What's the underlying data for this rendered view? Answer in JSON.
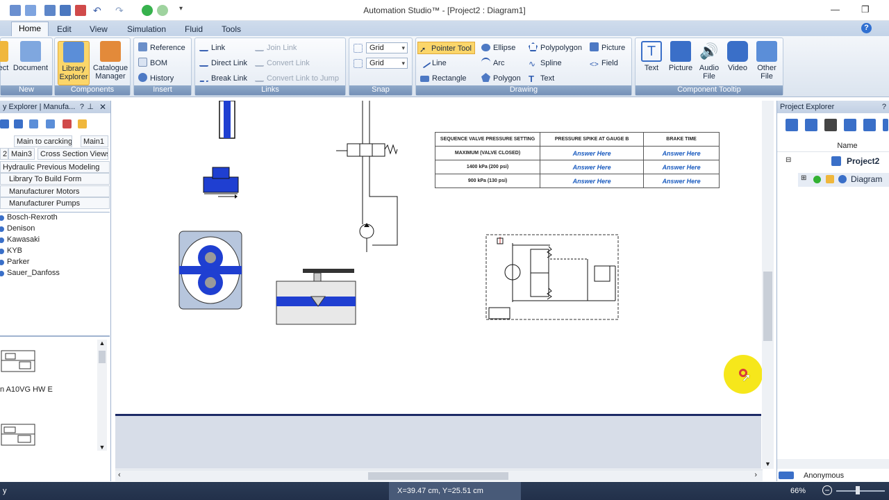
{
  "app": {
    "title": "Automation Studio™ - [Project2 : Diagram1]"
  },
  "tabs": [
    "Home",
    "Edit",
    "View",
    "Simulation",
    "Fluid",
    "Tools"
  ],
  "ribbon": {
    "new_group": {
      "label": "New",
      "object_btn": "ect",
      "document_btn": "Document"
    },
    "components_group": {
      "label": "Components",
      "library_explorer": "Library Explorer",
      "catalogue_manager": "Catalogue Manager"
    },
    "insert_group": {
      "label": "Insert",
      "reference": "Reference",
      "bom": "BOM",
      "history": "History"
    },
    "links_group": {
      "label": "Links",
      "link": "Link",
      "direct_link": "Direct Link",
      "break_link": "Break Link",
      "join_link": "Join Link",
      "convert_link": "Convert Link",
      "convert_link_jump": "Convert Link to Jump"
    },
    "snap_group": {
      "label": "Snap",
      "grid1": "Grid",
      "grid2": "Grid"
    },
    "drawing_group": {
      "label": "Drawing",
      "pointer_tool": "Pointer Tool",
      "line": "Line",
      "rectangle": "Rectangle",
      "ellipse": "Ellipse",
      "arc": "Arc",
      "polygon": "Polygon",
      "polypolygon": "Polypolygon",
      "spline": "Spline",
      "text": "Text",
      "picture": "Picture",
      "field": "Field"
    },
    "tooltip_group": {
      "label": "Component Tooltip",
      "text": "Text",
      "picture": "Picture",
      "audio": "Audio File",
      "video": "Video",
      "other": "Other File"
    }
  },
  "left_panel": {
    "title": "y Explorer | Manufa...",
    "tabs_row1": [
      "Main to carcking",
      "Main1"
    ],
    "tabs_row2": [
      "2",
      "Main3",
      "Cross Section Views"
    ],
    "items": [
      "Hydraulic Previous Modeling",
      "Library To Build Form",
      "Manufacturer Motors",
      "Manufacturer Pumps"
    ],
    "manufacturers": [
      "Bosch-Rexroth",
      "Denison",
      "Kawasaki",
      "KYB",
      "Parker",
      "Sauer_Danfoss"
    ],
    "preview_label": "n A10VG HW E"
  },
  "table": {
    "headers": [
      "SEQUENCE VALVE PRESSURE SETTING",
      "PRESSURE SPIKE AT GAUGE B",
      "BRAKE TIME"
    ],
    "rows": [
      [
        "MAXIMUM (VALVE CLOSED)",
        "Answer Here",
        "Answer Here"
      ],
      [
        "1400 kPa (200 psi)",
        "Answer Here",
        "Answer Here"
      ],
      [
        "900 kPa (130 psi)",
        "Answer Here",
        "Answer Here"
      ]
    ]
  },
  "right_panel": {
    "title": "Project Explorer",
    "column": "Name",
    "project": "Project2",
    "diagram": "Diagram",
    "user": "Anonymous"
  },
  "status": {
    "left": "y",
    "coords": "X=39.47 cm, Y=25.51 cm",
    "zoom": "66%"
  },
  "colors": {
    "accent_blue": "#1f3fd1",
    "ribbon_label": "#7490b7",
    "cursor_highlight": "#f5e60f"
  }
}
